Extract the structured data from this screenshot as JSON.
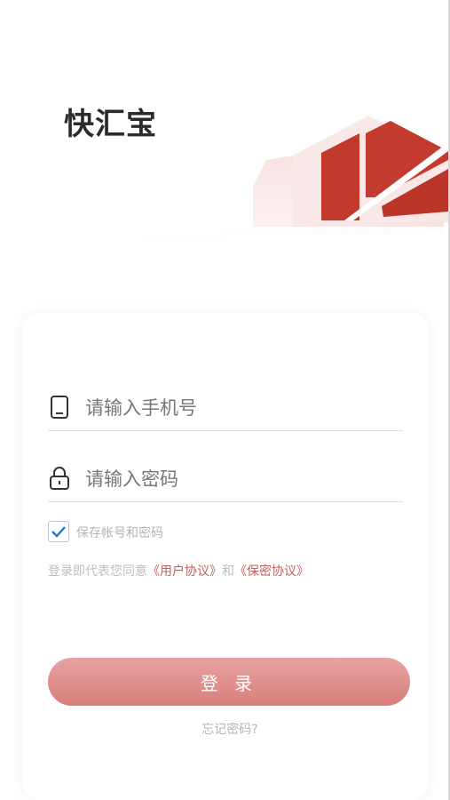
{
  "app": {
    "logo_text": "快汇宝"
  },
  "form": {
    "phone": {
      "placeholder": "请输入手机号",
      "icon": "phone-icon"
    },
    "password": {
      "placeholder": "请输入密码",
      "icon": "lock-icon"
    },
    "remember": {
      "label": "保存帐号和密码",
      "checked": true
    },
    "agreement": {
      "prefix": "登录即代表您同意",
      "user_agreement": "《用户协议》",
      "conjunction": "和",
      "privacy_agreement": "《保密协议》"
    },
    "login_button": "登 录",
    "forgot_password": "忘记密码?"
  },
  "colors": {
    "brand_red": "#c0392b",
    "button_gradient_start": "#e7a3a0",
    "button_gradient_end": "#d77f7b",
    "link": "#c25e5e",
    "checkbox_check": "#1e78d6"
  }
}
